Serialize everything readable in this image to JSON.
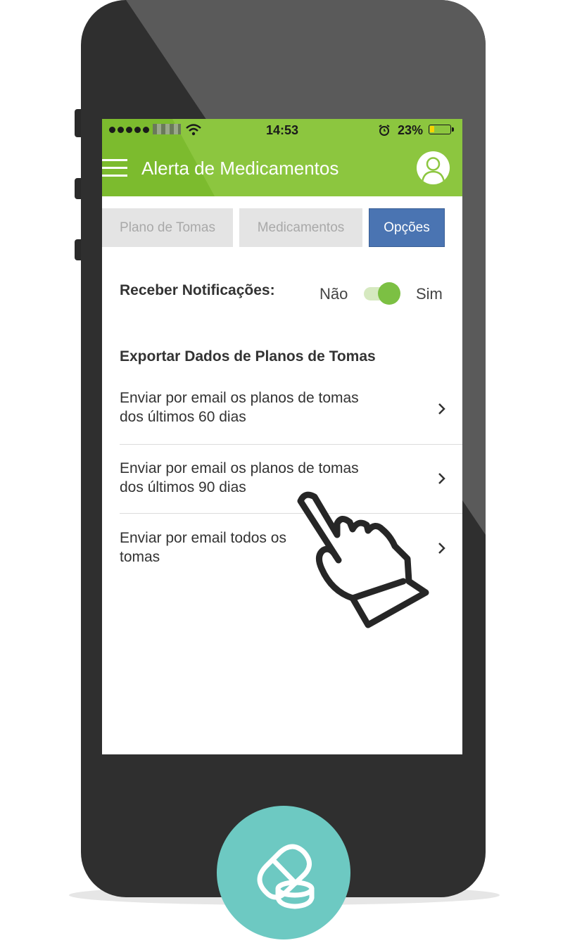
{
  "status_bar": {
    "time": "14:53",
    "battery_percent": "23%",
    "battery_level": 0.23,
    "battery_color": "#f7d200"
  },
  "app_bar": {
    "title": "Alerta de Medicamentos",
    "menu_icon": "hamburger-menu-icon",
    "profile_icon": "user-profile-icon",
    "color": "#8cc63f"
  },
  "tabs": [
    {
      "label": "Plano de Tomas",
      "selected": false
    },
    {
      "label": "Medicamentos",
      "selected": false
    },
    {
      "label": "Opções",
      "selected": true
    }
  ],
  "notifications": {
    "label": "Receber Notificações:",
    "off_label": "Não",
    "on_label": "Sim",
    "enabled": true
  },
  "export": {
    "title": "Exportar Dados de Planos de Tomas",
    "items": [
      {
        "line1": "Enviar por email os planos de tomas",
        "line2": "dos últimos 60 dias"
      },
      {
        "line1": "Enviar por email os planos de tomas",
        "line2": "dos últimos 90 dias"
      },
      {
        "line1": "Enviar por email todos os",
        "line2": "tomas"
      }
    ]
  },
  "overlay": {
    "pointer_icon": "hand-pointer-icon",
    "badge_icon": "pill-capsule-icon",
    "badge_color": "#6dc9c2"
  }
}
